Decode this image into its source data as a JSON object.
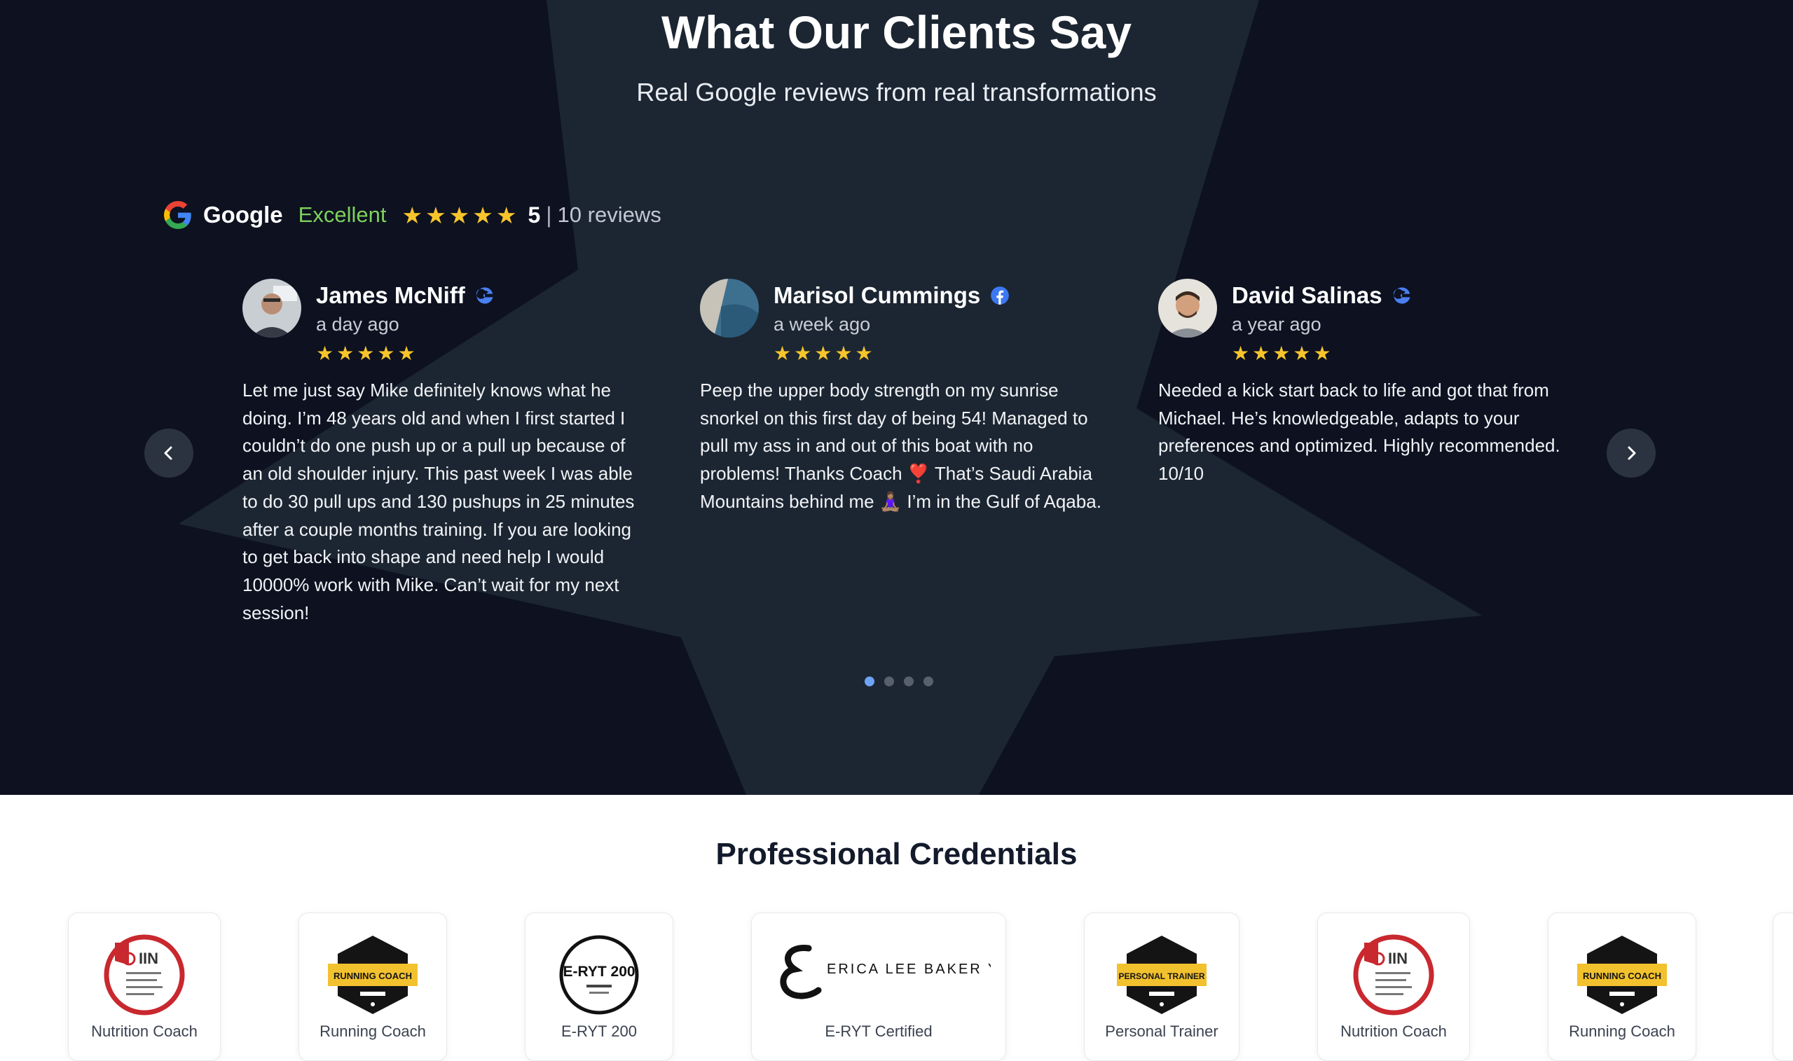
{
  "header": {
    "title": "What Our Clients Say",
    "subtitle": "Real Google reviews from real transformations"
  },
  "rating_summary": {
    "brand": "Google",
    "rating_word": "Excellent",
    "stars": 5,
    "score": "5",
    "separator": "|",
    "review_count": "10 reviews"
  },
  "reviews": [
    {
      "name": "James McNiff",
      "source": "google-icon",
      "age": "a day ago",
      "stars": 5,
      "text": "Let me just say Mike definitely knows what he doing. I’m 48 years old and when I first started I couldn’t do one push up or a pull up because of an old shoulder injury. This past week I was able to do 30 pull ups and 130 pushups in 25 minutes after a couple months training. If you are looking to get back into shape and need help I would 10000% work with Mike. Can’t wait for my next session!"
    },
    {
      "name": "Marisol Cummings",
      "source": "facebook-icon",
      "age": "a week ago",
      "stars": 5,
      "text": "Peep the upper body strength on my sunrise snorkel on this first day of being 54! Managed to pull my ass in and out of this boat with no problems! Thanks Coach ❣️ That’s Saudi Arabia Mountains behind me 🧘🏽‍♀️ I’m in the Gulf of Aqaba."
    },
    {
      "name": "David Salinas",
      "source": "google-icon",
      "age": "a year ago",
      "stars": 5,
      "text": "Needed a kick start back to life and got that from Michael. He’s knowledgeable, adapts to your preferences and optimized. Highly recommended. 10/10"
    }
  ],
  "carousel": {
    "prev_icon": "chevron-left-icon",
    "next_icon": "chevron-right-icon",
    "page_count": 4,
    "active_page": 1
  },
  "credentials": {
    "title": "Professional Credentials",
    "badges": [
      {
        "label": "Nutrition Coach",
        "icon": "iin-badge-icon",
        "badge_text": "IIN"
      },
      {
        "label": "Running Coach",
        "icon": "issa-running-coach-badge-icon",
        "badge_text": "RUNNING COACH"
      },
      {
        "label": "E-RYT 200",
        "icon": "yoga-alliance-badge-icon",
        "badge_text": "E-RYT 200"
      },
      {
        "label": "E-RYT Certified",
        "icon": "erica-lee-baker-yoga-logo",
        "badge_text": "ERICA LEE BAKER YOGA"
      },
      {
        "label": "Personal Trainer",
        "icon": "issa-personal-trainer-badge-icon",
        "badge_text": "PERSONAL TRAINER"
      },
      {
        "label": "Nutrition Coach",
        "icon": "iin-badge-icon",
        "badge_text": "IIN"
      },
      {
        "label": "Running Coach",
        "icon": "issa-running-coach-badge-icon",
        "badge_text": "RUNNING COACH"
      }
    ]
  },
  "colors": {
    "hero_background": "#0d1120",
    "star_shape": "#1c2632",
    "rating_star": "#f7c52b",
    "excellent_green": "#7ed15b",
    "active_dot": "#6ea3f5"
  }
}
